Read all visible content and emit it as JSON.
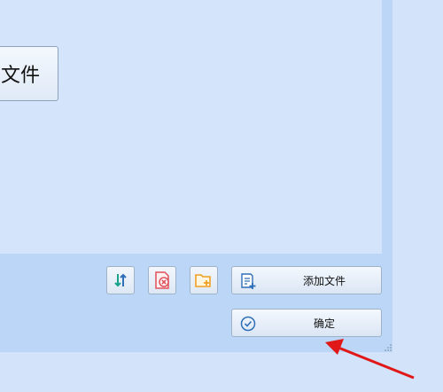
{
  "dialog": {
    "file_area_button_label": "文件",
    "add_file_label": "添加文件",
    "confirm_label": "确定"
  },
  "icons": {
    "sort": "sort-icon",
    "delete": "delete-icon",
    "add_folder": "add-folder-icon",
    "add_file": "add-file-icon",
    "confirm": "check-circle-icon"
  },
  "colors": {
    "background": "#d3e4fa",
    "panel": "#d4e5fb",
    "footer": "#bcd6f7",
    "accent_blue": "#2f6fb8",
    "teal": "#1aa38c",
    "delete_red": "#e0505a",
    "folder_orange": "#f0a021",
    "annotation_arrow": "#e01818"
  }
}
